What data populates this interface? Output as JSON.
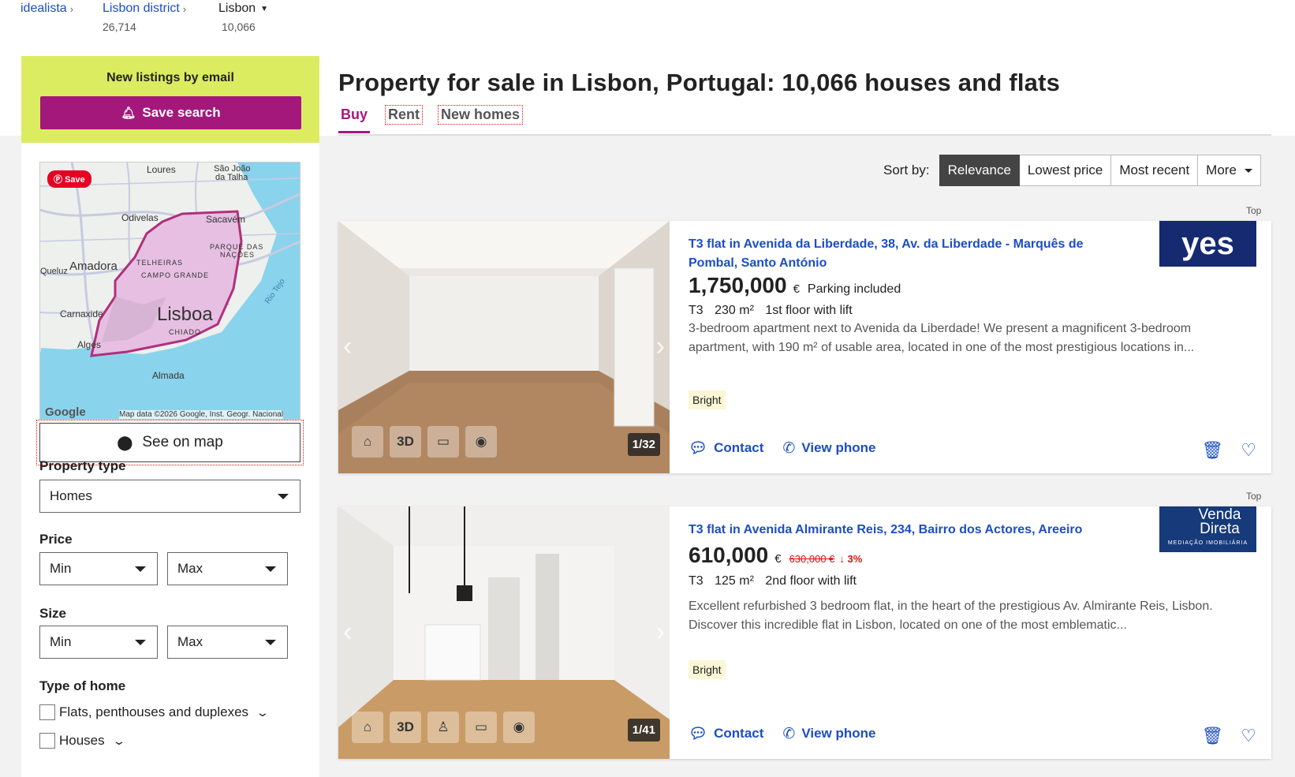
{
  "breadcrumb": {
    "root": "idealista",
    "district": "Lisbon district",
    "district_count": "26,714",
    "current": "Lisbon",
    "current_count": "10,066"
  },
  "alerts": {
    "title": "New listings by email",
    "button": "Save search"
  },
  "map": {
    "pin_save": "Save",
    "labels": {
      "loures": "Loures",
      "sao_joao": "São João",
      "da_talha": "da Talha",
      "odivelas": "Odivelas",
      "sacavem": "Sacavém",
      "parque": "PARQUE DAS",
      "nacoes": "NAÇÕES",
      "amadora": "Amadora",
      "queluz": "Queluz",
      "telheiras": "TELHEIRAS",
      "campo_grande": "CAMPO GRANDE",
      "carnaxide": "Carnaxide",
      "lisboa": "Lisboa",
      "chiado": "CHIADO",
      "alges": "Algés",
      "almada": "Almada",
      "rio_tejo": "Rio Tejo"
    },
    "google": "Google",
    "credit": "Map data ©2026 Google, Inst. Geogr. Nacional",
    "see_on_map": "See on map"
  },
  "filters": {
    "property_type_label": "Property type",
    "property_type_value": "Homes",
    "price_label": "Price",
    "price_min": "Min",
    "price_max": "Max",
    "size_label": "Size",
    "size_min": "Min",
    "size_max": "Max",
    "type_of_home_label": "Type of home",
    "opt_flats": "Flats, penthouses and duplexes",
    "opt_houses": "Houses"
  },
  "page": {
    "title": "Property for sale in Lisbon, Portugal: 10,066 houses and flats",
    "tabs": [
      "Buy",
      "Rent",
      "New homes"
    ]
  },
  "sort": {
    "label": "Sort by:",
    "options": [
      "Relevance",
      "Lowest price",
      "Most recent",
      "More"
    ]
  },
  "listings": [
    {
      "top": "Top",
      "title": "T3 flat in Avenida da Liberdade, 38, Av. da Liberdade - Marquês de Pombal, Santo António",
      "logo": "yes",
      "price": "1,750,000",
      "currency": "€",
      "extra": "Parking included",
      "rooms": "T3",
      "size": "230 m²",
      "floor": "1st floor with lift",
      "description": "3-bedroom apartment next to Avenida da Liberdade! We present a magnificent 3-bedroom apartment, with 190 m² of usable area, located in one of the most prestigious locations in...",
      "badge": "Bright",
      "photo_count": "1/32",
      "contact": "Contact",
      "phone": "View phone"
    },
    {
      "top": "Top",
      "title": "T3 flat in Avenida Almirante Reis, 234, Bairro dos Actores, Areeiro",
      "logo_line1": "Venda",
      "logo_line2": "Direta",
      "logo_sub": "MEDIAÇÃO IMOBILIÁRIA",
      "price": "610,000",
      "currency": "€",
      "old_price": "630,000 €",
      "drop": "3%",
      "rooms": "T3",
      "size": "125 m²",
      "floor": "2nd floor with lift",
      "description": "Excellent refurbished 3 bedroom flat, in the heart of the prestigious Av. Almirante Reis, Lisbon. Discover this incredible flat in Lisbon, located on one of the most emblematic...",
      "badge": "Bright",
      "photo_count": "1/41",
      "contact": "Contact",
      "phone": "View phone"
    }
  ],
  "colors": {
    "accent": "#a4187c",
    "link": "#1c4ec4",
    "alert_bg": "#dcec60"
  }
}
